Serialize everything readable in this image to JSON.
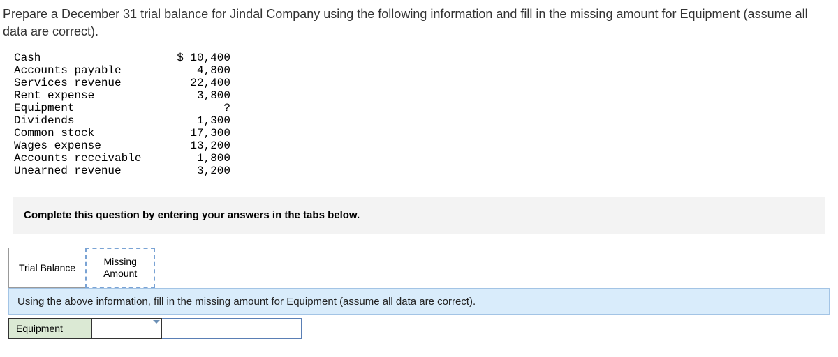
{
  "question": "Prepare a December 31 trial balance for Jindal Company using the following information and fill in the missing amount for Equipment (assume all data are correct).",
  "accounts": [
    {
      "name": "Cash",
      "value": "$ 10,400"
    },
    {
      "name": "Accounts payable",
      "value": "4,800"
    },
    {
      "name": "Services revenue",
      "value": "22,400"
    },
    {
      "name": "Rent expense",
      "value": "3,800"
    },
    {
      "name": "Equipment",
      "value": "?"
    },
    {
      "name": "Dividends",
      "value": "1,300"
    },
    {
      "name": "Common stock",
      "value": "17,300"
    },
    {
      "name": "Wages expense",
      "value": "13,200"
    },
    {
      "name": "Accounts receivable",
      "value": "1,800"
    },
    {
      "name": "Unearned revenue",
      "value": "3,200"
    }
  ],
  "instruction": "Complete this question by entering your answers in the tabs below.",
  "tabs": {
    "trial_balance": "Trial Balance",
    "missing_amount": "Missing\nAmount"
  },
  "sub_instruction": "Using the above information, fill in the missing amount for Equipment (assume all data are correct).",
  "answer_label": "Equipment"
}
